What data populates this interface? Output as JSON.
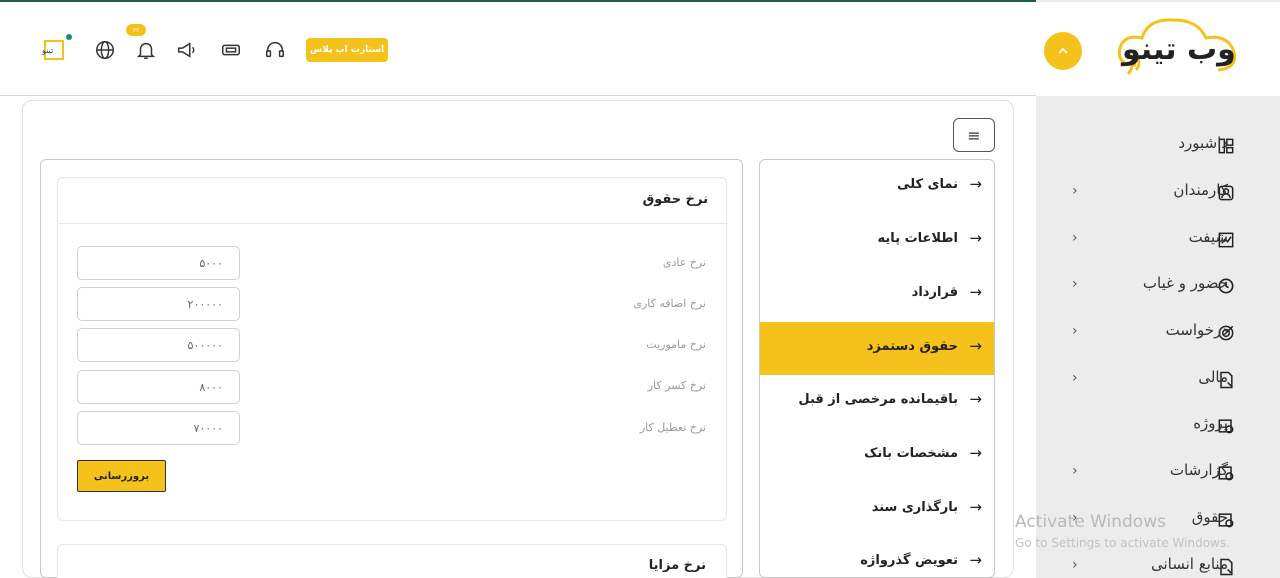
{
  "header": {
    "startup_button": "استارت اپ پلاس",
    "notification_count": "۳۲",
    "brand_mini": "تینو",
    "icons": [
      "brand-logo-icon",
      "globe-icon",
      "bell-icon",
      "megaphone-icon",
      "ticket-icon",
      "headset-icon"
    ]
  },
  "sidebar": {
    "logo_text": "وب تینو",
    "items": [
      {
        "label": "داشبورد",
        "icon": "dashboard-icon",
        "has_chevron": false
      },
      {
        "label": "کارمندان",
        "icon": "user-icon",
        "has_chevron": true
      },
      {
        "label": "شیفت",
        "icon": "chart-icon",
        "has_chevron": true
      },
      {
        "label": "حضور و غیاب",
        "icon": "clock-icon",
        "has_chevron": true
      },
      {
        "label": "درخواست",
        "icon": "target-icon",
        "has_chevron": true
      },
      {
        "label": "مالی",
        "icon": "file-icon",
        "has_chevron": true
      },
      {
        "label": "پروژه",
        "icon": "calendar-clock-icon",
        "has_chevron": false
      },
      {
        "label": "گزارشات",
        "icon": "calendar-clock-icon",
        "has_chevron": true
      },
      {
        "label": "حقوق",
        "icon": "calendar-clock-icon",
        "has_chevron": true
      },
      {
        "label": "منابع انسانی",
        "icon": "file-icon",
        "has_chevron": true
      }
    ]
  },
  "nav": {
    "items": [
      {
        "label": "نمای کلی",
        "active": false
      },
      {
        "label": "اطلاعات پایه",
        "active": false
      },
      {
        "label": "قرارداد",
        "active": false
      },
      {
        "label": "حقوق دستمزد",
        "active": true
      },
      {
        "label": "باقیمانده مرخصی از قبل",
        "active": false
      },
      {
        "label": "مشخصات بانک",
        "active": false
      },
      {
        "label": "بارگذاری سند",
        "active": false
      },
      {
        "label": "تعویض گذرواژه",
        "active": false
      }
    ]
  },
  "salary_rates": {
    "title": "نرخ حقوق",
    "rows": [
      {
        "label": "نرخ عادی",
        "value": "۵۰۰۰"
      },
      {
        "label": "نرخ اضافه کاری",
        "value": "۲۰۰۰۰۰"
      },
      {
        "label": "نرخ ماموریت",
        "value": "۵۰۰۰۰۰"
      },
      {
        "label": "نرخ کسر کار",
        "value": "۸۰۰۰"
      },
      {
        "label": "نرخ تعطیل کار",
        "value": "۷۰۰۰۰"
      }
    ],
    "update_button": "بروزرسانی"
  },
  "benefits": {
    "title": "نرخ مزایا"
  },
  "watermark": {
    "line1": "Activate Windows",
    "line2": "Go to Settings to activate Windows."
  },
  "colors": {
    "accent": "#f5c11b",
    "topline": "#1f5c4e"
  }
}
